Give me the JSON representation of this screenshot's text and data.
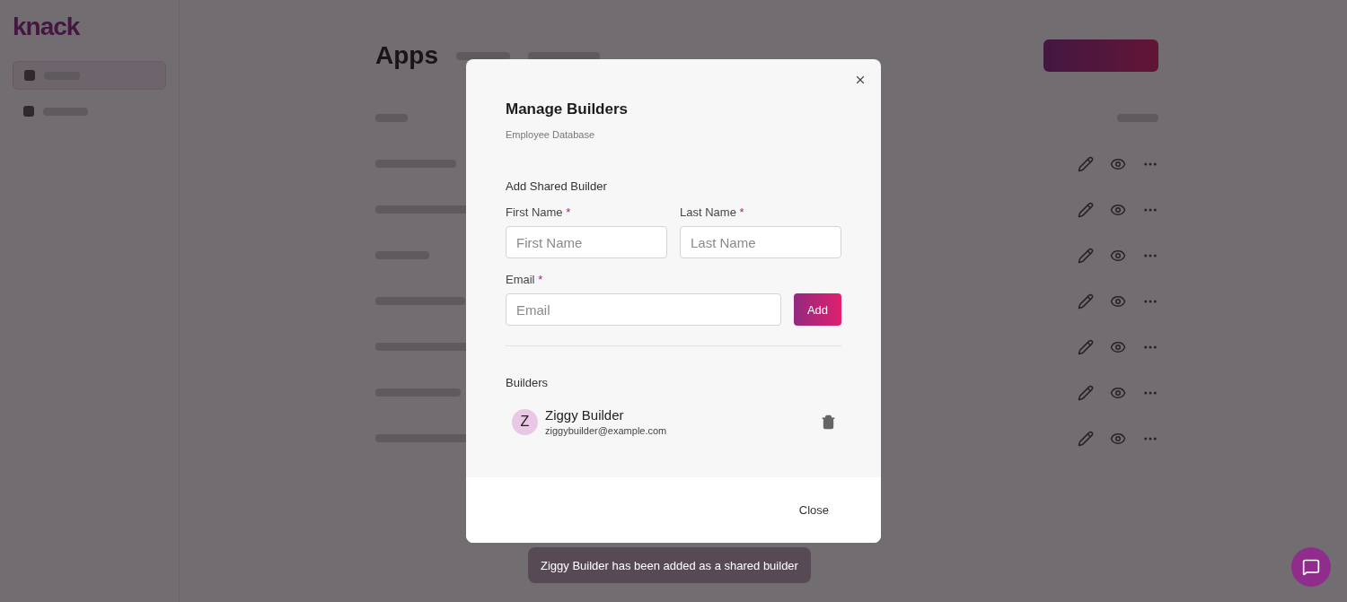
{
  "logo": {
    "text": "knack"
  },
  "page": {
    "title": "Apps"
  },
  "modal": {
    "title": "Manage Builders",
    "subtitle": "Employee Database",
    "section_title": "Add Shared Builder",
    "name_fields": [
      {
        "label": "First Name",
        "required_mark": "*",
        "placeholder": "First Name"
      },
      {
        "label": "Last Name",
        "required_mark": "*",
        "placeholder": "Last Name"
      }
    ],
    "email_field": {
      "label": "Email",
      "required_mark": "*",
      "placeholder": "Email"
    },
    "add_button": "Add",
    "builders_title": "Builders",
    "builders": [
      {
        "initial": "Z",
        "name": "Ziggy Builder",
        "email": "ziggybuilder@example.com"
      }
    ],
    "close_button": "Close"
  },
  "toast": {
    "text": "Ziggy Builder has been added as a shared builder"
  }
}
